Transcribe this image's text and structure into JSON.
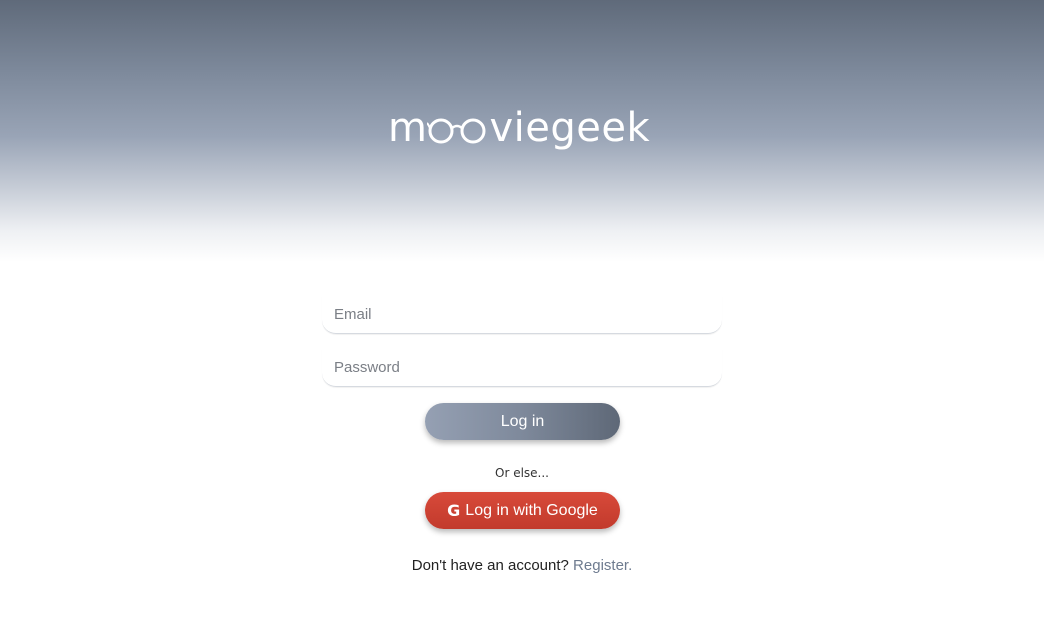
{
  "brand": {
    "logo_text_prefix": "m",
    "logo_text_suffix": "viegeek",
    "logo_full": "mooviegeek"
  },
  "form": {
    "email_placeholder": "Email",
    "password_placeholder": "Password",
    "email_value": "",
    "password_value": ""
  },
  "actions": {
    "login_label": "Log in",
    "separator_text": "Or else...",
    "google_label": "Log in with Google",
    "google_icon": "google-g-icon"
  },
  "footer": {
    "prompt": "Don't have an account? ",
    "register_label": "Register",
    "trailing": "."
  },
  "colors": {
    "header_top": "#5f6a7a",
    "login_button": "#7e899b",
    "google_button": "#d04436",
    "register_link": "#6e7b8f"
  }
}
